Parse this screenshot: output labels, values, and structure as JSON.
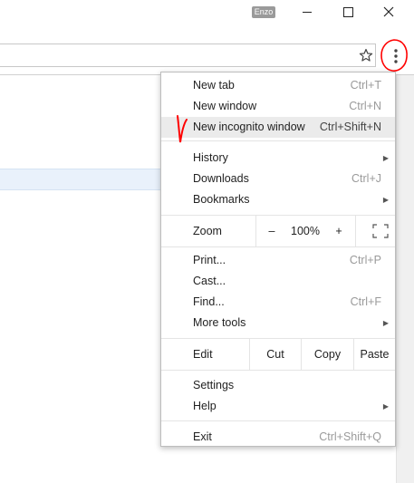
{
  "window": {
    "profile_name": "Enzo",
    "controls": [
      "minimize",
      "maximize",
      "close"
    ]
  },
  "toolbar": {
    "bookmark_icon": "star-icon",
    "menu_icon": "vertical-dots-icon"
  },
  "menu": {
    "items": [
      {
        "label": "New tab",
        "shortcut": "Ctrl+T"
      },
      {
        "label": "New window",
        "shortcut": "Ctrl+N"
      },
      {
        "label": "New incognito window",
        "shortcut": "Ctrl+Shift+N"
      },
      {
        "label": "History",
        "submenu": true
      },
      {
        "label": "Downloads",
        "shortcut": "Ctrl+J"
      },
      {
        "label": "Bookmarks",
        "submenu": true
      },
      {
        "label": "Print...",
        "shortcut": "Ctrl+P"
      },
      {
        "label": "Cast..."
      },
      {
        "label": "Find...",
        "shortcut": "Ctrl+F"
      },
      {
        "label": "More tools",
        "submenu": true
      },
      {
        "label": "Settings"
      },
      {
        "label": "Help",
        "submenu": true
      },
      {
        "label": "Exit",
        "shortcut": "Ctrl+Shift+Q"
      }
    ],
    "zoom": {
      "label": "Zoom",
      "decrease": "–",
      "value": "100%",
      "increase": "+",
      "fullscreen_icon": "fullscreen-icon"
    },
    "edit": {
      "label": "Edit",
      "cut": "Cut",
      "copy": "Copy",
      "paste": "Paste"
    },
    "highlighted_item": "New incognito window"
  },
  "annotations": {
    "color": "#ff0000",
    "shapes": [
      "circle-around-menu-button",
      "check-mark-next-to-incognito"
    ]
  },
  "colors": {
    "menu_hover": "#ebebeb",
    "shortcut_text": "#9a9a9a",
    "annotation": "#ff0000"
  }
}
